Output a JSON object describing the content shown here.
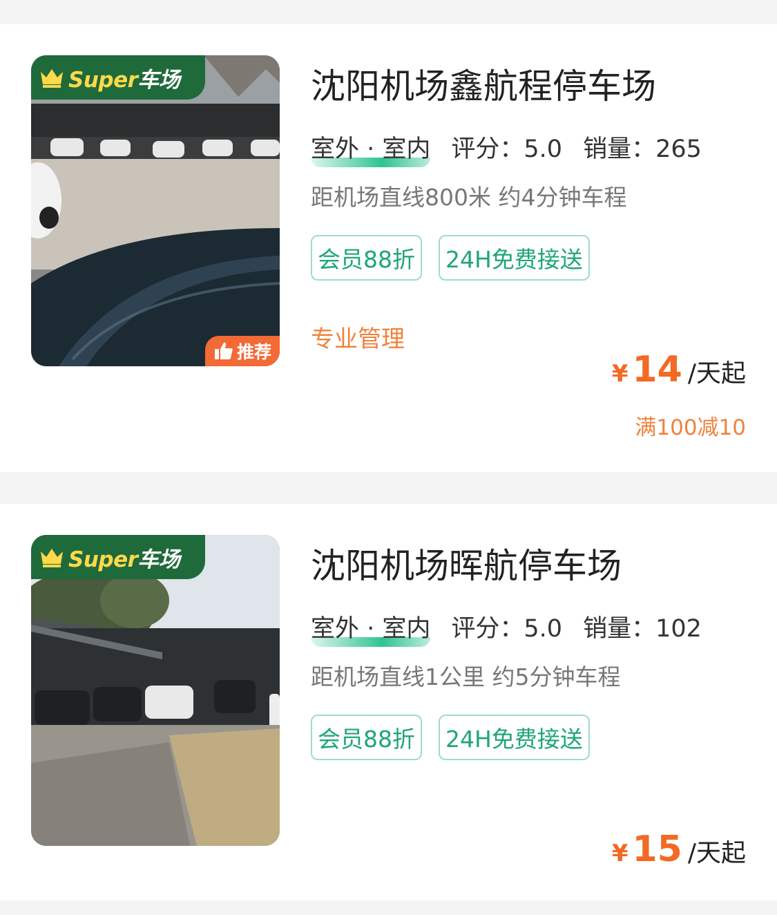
{
  "listings": [
    {
      "badge": "Super车场",
      "badge_latin": "Super",
      "badge_cn": "车场",
      "recommend_label": "推荐",
      "name": "沈阳机场鑫航程停车场",
      "parking_type": "室外 · 室内",
      "rating": "评分：5.0",
      "sales": "销量：265",
      "distance": "距机场直线800米 约4分钟车程",
      "tags": [
        "会员88折",
        "24H免费接送"
      ],
      "feature": "专业管理",
      "currency": "¥",
      "price": "14",
      "price_unit": "/天起",
      "discount": "满100减10"
    },
    {
      "badge": "Super车场",
      "badge_latin": "Super",
      "badge_cn": "车场",
      "name": "沈阳机场晖航停车场",
      "parking_type": "室外 · 室内",
      "rating": "评分：5.0",
      "sales": "销量：102",
      "distance": "距机场直线1公里 约5分钟车程",
      "tags": [
        "会员88折",
        "24H免费接送"
      ],
      "currency": "¥",
      "price": "15",
      "price_unit": "/天起"
    }
  ],
  "colors": {
    "badge_bg": "#1f6a3a",
    "badge_gold": "#ffd94a",
    "accent_orange": "#f36a24",
    "tag_green": "#1fa57b",
    "tag_border": "#9fdcc6"
  },
  "icons": [
    "crown-icon",
    "thumbs-up-icon"
  ]
}
